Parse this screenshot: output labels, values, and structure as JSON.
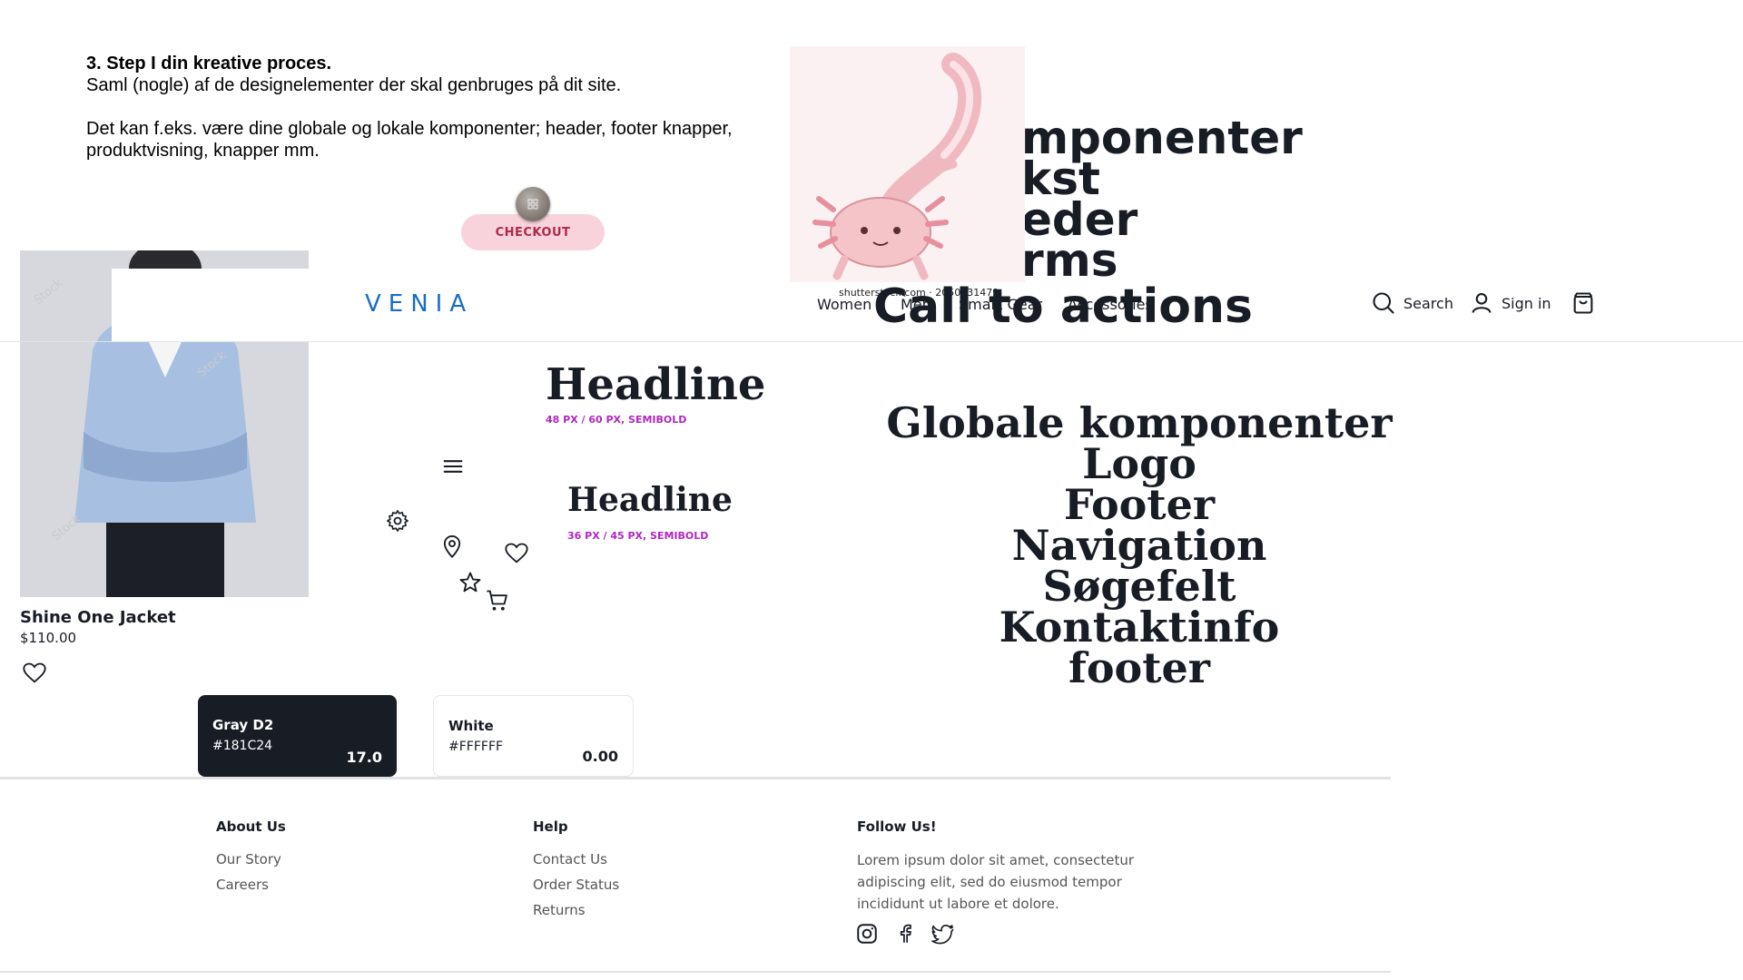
{
  "intro": {
    "step_title": "3. Step I din kreative proces.",
    "line1": "Saml (nogle) af de designelementer der skal genbruges på dit site.",
    "line2": "Det kan f.eks. være dine globale og lokale komponenter; header, footer knapper,",
    "line3": "produktvisning, knapper mm."
  },
  "checkout": {
    "label": "CHECKOUT"
  },
  "image": {
    "caption": "shutterstock.com · 2050431479"
  },
  "components_list": [
    "mponenter",
    "kst",
    "eder",
    "rms"
  ],
  "cta_text": "Call to actions",
  "product": {
    "name": "Shine One Jacket",
    "price": "$110.00",
    "watermark": "Stock"
  },
  "header": {
    "logo": "VENIA",
    "nav": [
      "Women",
      "Men",
      "Smart Gear",
      "Accessories"
    ],
    "search_label": "Search",
    "signin_label": "Sign in"
  },
  "headlines": {
    "h1": "Headline",
    "h1_meta": "48 PX / 60 PX, SEMIBOLD",
    "h2": "Headline",
    "h2_meta": "36 PX / 45 PX, SEMIBOLD"
  },
  "globale": {
    "items": [
      "Globale komponenter",
      "Logo",
      "Footer",
      "Navigation",
      "Søgefelt",
      "Kontaktinfo",
      "footer"
    ]
  },
  "swatches": [
    {
      "name": "Gray D2",
      "hex": "#181C24",
      "value": "17.0"
    },
    {
      "name": "White",
      "hex": "#FFFFFF",
      "value": "0.00"
    }
  ],
  "footer": {
    "about": {
      "title": "About Us",
      "links": [
        "Our Story",
        "Careers"
      ]
    },
    "help": {
      "title": "Help",
      "links": [
        "Contact Us",
        "Order Status",
        "Returns"
      ]
    },
    "follow": {
      "title": "Follow Us!",
      "text": "Lorem ipsum dolor sit amet, consectetur adipiscing elit, sed do eiusmod tempor incididunt ut labore et dolore.",
      "icons": [
        "instagram-icon",
        "facebook-icon",
        "twitter-icon"
      ]
    }
  },
  "colors": {
    "dark": "#181C24",
    "checkout_bg": "#f8d3dc",
    "checkout_text": "#b0294b",
    "meta_purple": "#b027c2",
    "brand_blue": "#1a6dc4"
  }
}
